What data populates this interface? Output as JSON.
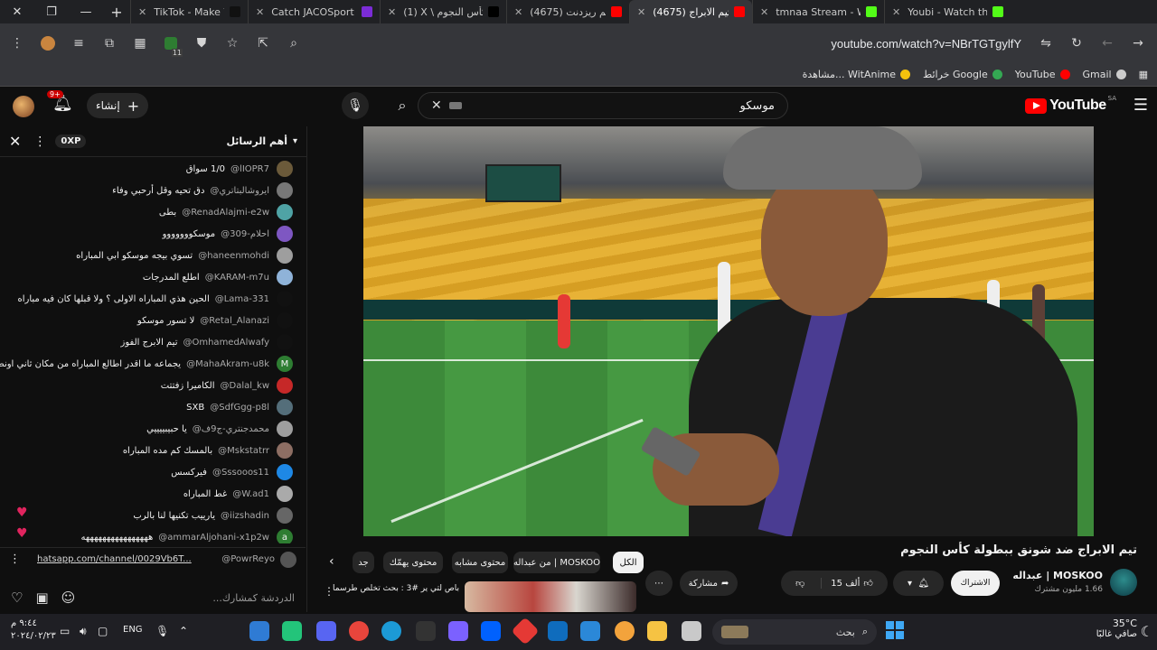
{
  "browser": {
    "tabs": [
      {
        "title": "TikTok - Make Your D",
        "fav": "#111111"
      },
      {
        "title": "Catch JACOSport Live",
        "fav": "#7b2cd6"
      },
      {
        "title": "(1) X \\ كأس النجوم @",
        "fav": "#000000"
      },
      {
        "title": "(4675) تختيم ريزدنت",
        "fav": "#ff0000"
      },
      {
        "title": "(4675) تيم الابراج",
        "fav": "#ff0000",
        "active": true
      },
      {
        "title": "tmnaa Stream - Watc",
        "fav": "#53fc18"
      },
      {
        "title": "Youbi - Watch the V",
        "fav": "#53fc18"
      }
    ],
    "url": "youtube.com/watch?v=NBrTGTgylfY",
    "bookmarks": [
      {
        "label": "Gmail",
        "color": "#cccccc"
      },
      {
        "label": "YouTube",
        "color": "#ff0000"
      },
      {
        "label": "خرائط Google",
        "color": "#34a853"
      },
      {
        "label": "مشاهدة... WitAnime",
        "color": "#f4c20d"
      }
    ],
    "extension_badge": "11"
  },
  "youtube": {
    "logo": "YouTube",
    "region": "SA",
    "search_value": "موسكو",
    "create_label": "إنشاء",
    "notif_count": "9+"
  },
  "chat": {
    "header_title": "أهم الرسائل",
    "xp_label": "0XP",
    "messages": [
      {
        "author": "@lIOPR7",
        "text": "1/0 سواق",
        "av": "#6b5a3a"
      },
      {
        "author": "@ايروشالبتاتري",
        "text": "دق تحيه وقل أرحبي وفاء",
        "av": "#777777"
      },
      {
        "author": "@RenadAlajmi-e2w",
        "text": "بطى",
        "av": "#4fa3a5"
      },
      {
        "author": "@احلام-309",
        "text": "موسكووووووو",
        "av": "#7e57c2"
      },
      {
        "author": "@haneenmohdi",
        "text": "تسوي بيجه موسكو ابي المباراه",
        "av": "#9e9e9e"
      },
      {
        "author": "@KARAM-m7u",
        "text": "اطلع المدرجات",
        "av": "#8fb3d9"
      },
      {
        "author": "@Lama-331",
        "text": "الحين هذي المباراه الاولى ؟ ولا قبلها كان فيه مباراه",
        "av": "#111111"
      },
      {
        "author": "@Retal_Alanazi",
        "text": "لا تسور موسكو",
        "av": "#111111"
      },
      {
        "author": "@OmhamedAlwafy",
        "text": "تيم الابرج الفوز",
        "av": "#111111"
      },
      {
        "author": "@MahaAkram-u8k",
        "text": "يجماعه ما اقدر اطالع المباراه من مكان ثاني اونضح",
        "av": "#2e7d32",
        "initial": "M"
      },
      {
        "author": "@Dalal_kw",
        "text": "الكاميرا زفتتت",
        "av": "#c62828"
      },
      {
        "author": "@SdfGgg-p8l",
        "text": "SXB",
        "av": "#546e7a"
      },
      {
        "author": "@محمدجنتري-ج9ف",
        "text": "يا حبيبييييي",
        "av": "#9e9e9e"
      },
      {
        "author": "@Mskstatrr",
        "text": "بالمسك كم مده المباراه",
        "av": "#8d6e63"
      },
      {
        "author": "@Sssooos11",
        "text": "فيركسس",
        "av": "#1e88e5"
      },
      {
        "author": "@W.ad1",
        "text": "غط المباراه",
        "av": "#aaaaaa"
      },
      {
        "author": "@iizshadin",
        "text": "يارييب تكنيها لنا بالرب",
        "av": "#666666"
      },
      {
        "author": "@ammarAljohani-x1p2w",
        "text": "ههههههههههههههههه",
        "av": "#2e7d32",
        "initial": "a"
      }
    ],
    "pinned": {
      "author": "@PowrReyo",
      "link": "hatsapp.com/channel/0029Vb6T..."
    },
    "input_placeholder": "الدردشة كمشارك..."
  },
  "video": {
    "title": "تيم الابراج ضد شونق ببطولة كأس النجوم",
    "channel_name": "عبداله | MOSKOO",
    "subscribers": "1.66 مليون مشترك",
    "subscribe_label": "الاشتراك",
    "likes": "15 ألف",
    "share_label": "مشاركة"
  },
  "related": {
    "chips": [
      {
        "label": "الكل",
        "selected": true
      },
      {
        "label": "من عبداله | MOSKOO",
        "selected": false
      },
      {
        "label": "محتوى مشابه",
        "selected": false
      },
      {
        "label": "محتوى يهمّك",
        "selected": false
      },
      {
        "label": "جد",
        "selected": false
      }
    ],
    "card_title": "باص لتي ير #3 : بحث تخلص طرسما"
  },
  "taskbar": {
    "temp": "35°C",
    "weather_desc": "صافي غالبًا",
    "search_placeholder": "بحث",
    "lang": "ENG",
    "time": "٩:٤٤ م",
    "date": "٢٠٢٤/٠٢/٢٣"
  }
}
